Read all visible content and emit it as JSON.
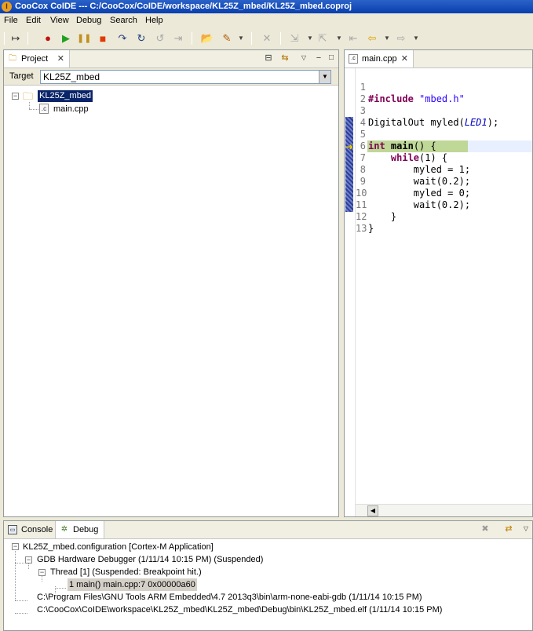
{
  "window": {
    "title": "CooCox CoIDE --- C:/CooCox/CoIDE/workspace/KL25Z_mbed/KL25Z_mbed.coproj",
    "icon": "coide-logo-icon"
  },
  "menu": [
    "File",
    "Edit",
    "View",
    "Debug",
    "Search",
    "Help"
  ],
  "project_panel": {
    "tab_label": "Project",
    "target_label": "Target",
    "target_value": "KL25Z_mbed",
    "tree": {
      "root": "KL25Z_mbed",
      "children": [
        "main.cpp"
      ]
    }
  },
  "editor": {
    "tab_label": "main.cpp",
    "lines": [
      {
        "n": "1",
        "text": "#include \"mbed.h\""
      },
      {
        "n": "2",
        "text": ""
      },
      {
        "n": "3",
        "text": "DigitalOut myled(LED1);"
      },
      {
        "n": "4",
        "text": ""
      },
      {
        "n": "5",
        "text": "int main() {"
      },
      {
        "n": "6",
        "text": "    while(1) {"
      },
      {
        "n": "7",
        "text": "        myled = 1;"
      },
      {
        "n": "8",
        "text": "        wait(0.2);"
      },
      {
        "n": "9",
        "text": "        myled = 0;"
      },
      {
        "n": "10",
        "text": "        wait(0.2);"
      },
      {
        "n": "11",
        "text": "    }"
      },
      {
        "n": "12",
        "text": "}"
      },
      {
        "n": "13",
        "text": ""
      }
    ],
    "current_line": "7"
  },
  "bottom_panel": {
    "tabs": [
      "Console",
      "Debug"
    ],
    "active_tab": "Debug",
    "tree": {
      "launch": "KL25Z_mbed.configuration [Cortex-M Application]",
      "debugger": "GDB Hardware Debugger (1/11/14 10:15 PM) (Suspended)",
      "thread": "Thread [1] (Suspended: Breakpoint hit.)",
      "frame": "1 main() main.cpp:7 0x00000a60",
      "gdb_path": "C:\\Program Files\\GNU Tools ARM Embedded\\4.7 2013q3\\bin\\arm-none-eabi-gdb (1/11/14 10:15 PM)",
      "elf_path": "C:\\CooCox\\CoIDE\\workspace\\KL25Z_mbed\\KL25Z_mbed\\Debug\\bin\\KL25Z_mbed.elf (1/11/14 10:15 PM)"
    }
  },
  "colors": {
    "title_bar": "#0a3fae",
    "current_line_highlight": "#bfd898",
    "keyword": "#7f0055",
    "string": "#2a00ff"
  }
}
